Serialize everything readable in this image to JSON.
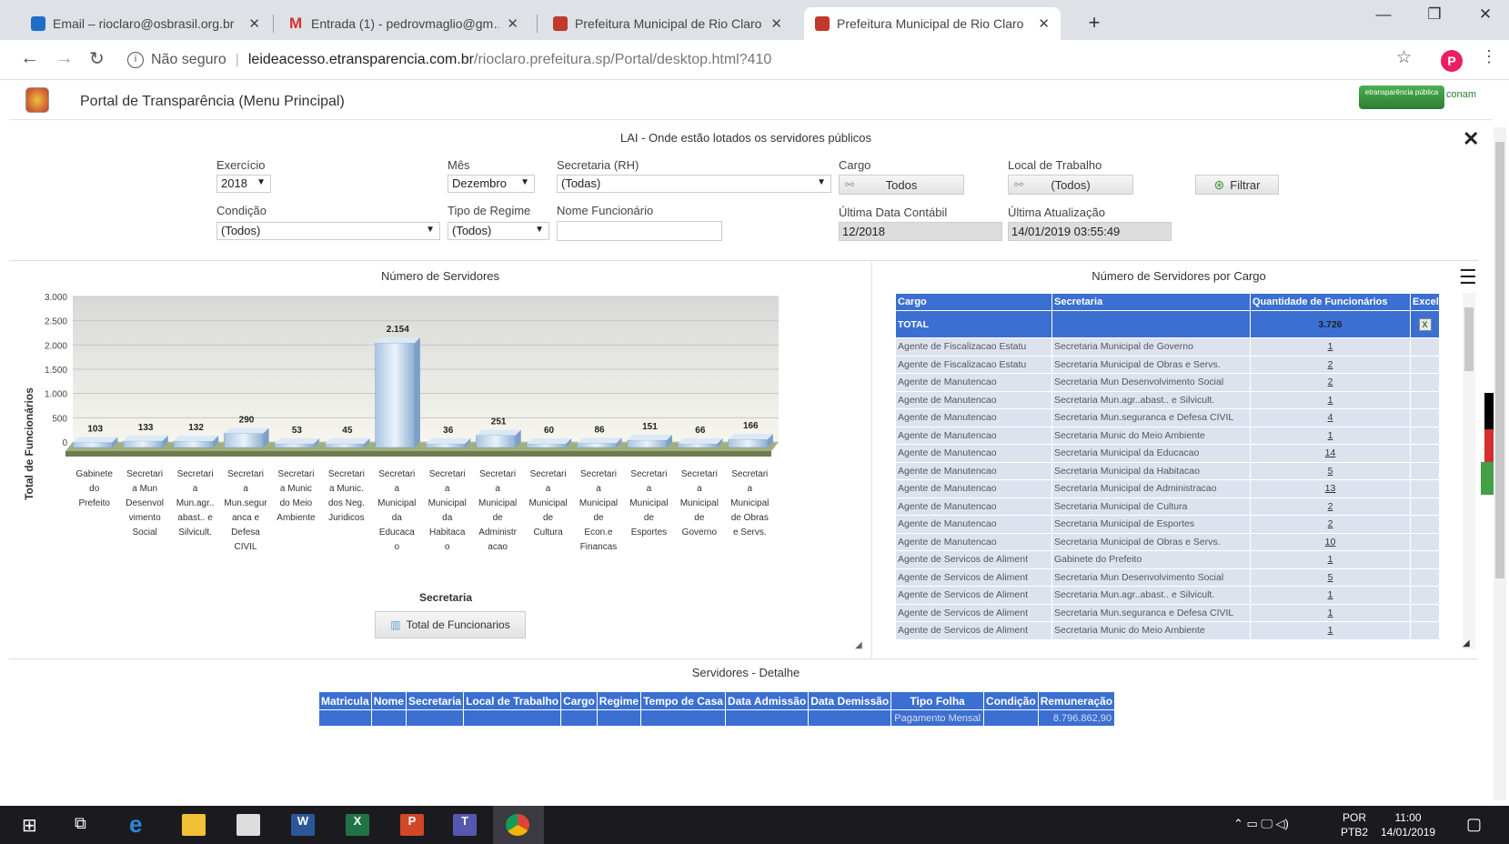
{
  "browser": {
    "tabs": [
      {
        "title": "Email – rioclaro@osbrasil.org.br",
        "icon_color": "#1f6fc8"
      },
      {
        "title": "Entrada (1) - pedrovmaglio@gm…",
        "icon_color": "#d93025"
      },
      {
        "title": "Prefeitura Municipal de Rio Claro",
        "icon_color": "#c0392b"
      },
      {
        "title": "Prefeitura Municipal de Rio Claro",
        "icon_color": "#c0392b"
      }
    ],
    "new_tab": "+",
    "not_secure": "Não seguro",
    "url_host": "leideacesso.etransparencia.com.br",
    "url_path": "/rioclaro.prefeitura.sp/Portal/desktop.html?410",
    "profile_initial": "P",
    "profile_color": "#e91e63"
  },
  "portal": {
    "title": "Portal de Transparência (Menu Principal)",
    "logo_text": "etransparência pública",
    "logo2_text": "conam"
  },
  "filters": {
    "panel_title": "LAI - Onde estão lotados os servidores públicos",
    "exercicio_label": "Exercício",
    "exercicio_value": "2018",
    "mes_label": "Mês",
    "mes_value": "Dezembro",
    "secretaria_label": "Secretaria (RH)",
    "secretaria_value": "(Todas)",
    "cargo_label": "Cargo",
    "cargo_value": "Todos",
    "local_label": "Local de Trabalho",
    "local_value": "(Todos)",
    "filtrar_label": "Filtrar",
    "condicao_label": "Condição",
    "condicao_value": "(Todos)",
    "regime_label": "Tipo de Regime",
    "regime_value": "(Todos)",
    "nome_label": "Nome Funcionário",
    "nome_value": "",
    "ultima_data_label": "Última Data Contábil",
    "ultima_data_value": "12/2018",
    "ultima_atual_label": "Última Atualização",
    "ultima_atual_value": "14/01/2019 03:55:49"
  },
  "chart_panel": {
    "title": "Número de Servidores",
    "button_label": "Total de Funcionarios"
  },
  "chart_data": {
    "type": "bar",
    "title": "",
    "xlabel": "Secretaria",
    "ylabel": "Total de Funcionários",
    "ylim": [
      0,
      3000
    ],
    "yticks": [
      "3.000",
      "2.500",
      "2.000",
      "1.500",
      "1.000",
      "500",
      "0"
    ],
    "categories": [
      [
        "Gabinete",
        "do",
        "Prefeito"
      ],
      [
        "Secretari",
        "a Mun",
        "Desenvol",
        "vimento",
        "Social"
      ],
      [
        "Secretari",
        "a",
        "Mun.agr..",
        "abast.. e",
        "Silvicult."
      ],
      [
        "Secretari",
        "a",
        "Mun.segur",
        "anca e",
        "Defesa",
        "CIVIL"
      ],
      [
        "Secretari",
        "a Munic",
        "do Meio",
        "Ambiente"
      ],
      [
        "Secretari",
        "a Munic.",
        "dos Neg.",
        "Juridicos"
      ],
      [
        "Secretari",
        "a",
        "Municipal",
        "da",
        "Educaca",
        "o"
      ],
      [
        "Secretari",
        "a",
        "Municipal",
        "da",
        "Habitaca",
        "o"
      ],
      [
        "Secretari",
        "a",
        "Municipal",
        "de",
        "Administr",
        "acao"
      ],
      [
        "Secretari",
        "a",
        "Municipal",
        "de",
        "Cultura"
      ],
      [
        "Secretari",
        "a",
        "Municipal",
        "de",
        "Econ.e",
        "Financas"
      ],
      [
        "Secretari",
        "a",
        "Municipal",
        "de",
        "Esportes"
      ],
      [
        "Secretari",
        "a",
        "Municipal",
        "de",
        "Governo"
      ],
      [
        "Secretari",
        "a",
        "Municipal",
        "de Obras",
        "e Servs."
      ]
    ],
    "values": [
      103,
      133,
      132,
      290,
      53,
      45,
      2154,
      36,
      251,
      60,
      86,
      151,
      66,
      166
    ],
    "labels": [
      "103",
      "133",
      "132",
      "290",
      "53",
      "45",
      "2.154",
      "36",
      "251",
      "60",
      "86",
      "151",
      "66",
      "166"
    ],
    "grid": true,
    "style": "3d"
  },
  "grid_panel": {
    "title": "Número de Servidores por Cargo",
    "headers": [
      "Cargo",
      "Secretaria",
      "Quantidade de Funcionários",
      "Excel"
    ],
    "total_label": "TOTAL",
    "total_value": "3.726",
    "rows": [
      {
        "cargo": "Agente de Fiscalizacao Estatu",
        "sec": "Secretaria Municipal de Governo",
        "q": "1"
      },
      {
        "cargo": "Agente de Fiscalizacao Estatu",
        "sec": "Secretaria Municipal de Obras e Servs.",
        "q": "2"
      },
      {
        "cargo": "Agente de Manutencao",
        "sec": "Secretaria Mun Desenvolvimento Social",
        "q": "2"
      },
      {
        "cargo": "Agente de Manutencao",
        "sec": "Secretaria Mun.agr..abast.. e Silvicult.",
        "q": "1"
      },
      {
        "cargo": "Agente de Manutencao",
        "sec": "Secretaria Mun.seguranca e Defesa CIVIL",
        "q": "4"
      },
      {
        "cargo": "Agente de Manutencao",
        "sec": "Secretaria Munic do Meio Ambiente",
        "q": "1"
      },
      {
        "cargo": "Agente de Manutencao",
        "sec": "Secretaria Municipal da Educacao",
        "q": "14"
      },
      {
        "cargo": "Agente de Manutencao",
        "sec": "Secretaria Municipal da Habitacao",
        "q": "5"
      },
      {
        "cargo": "Agente de Manutencao",
        "sec": "Secretaria Municipal de Administracao",
        "q": "13"
      },
      {
        "cargo": "Agente de Manutencao",
        "sec": "Secretaria Municipal de Cultura",
        "q": "2"
      },
      {
        "cargo": "Agente de Manutencao",
        "sec": "Secretaria Municipal de Esportes",
        "q": "2"
      },
      {
        "cargo": "Agente de Manutencao",
        "sec": "Secretaria Municipal de Obras e Servs.",
        "q": "10"
      },
      {
        "cargo": "Agente de Servicos de Aliment",
        "sec": "Gabinete do Prefeito",
        "q": "1"
      },
      {
        "cargo": "Agente de Servicos de Aliment",
        "sec": "Secretaria Mun Desenvolvimento Social",
        "q": "5"
      },
      {
        "cargo": "Agente de Servicos de Aliment",
        "sec": "Secretaria Mun.agr..abast.. e Silvicult.",
        "q": "1"
      },
      {
        "cargo": "Agente de Servicos de Aliment",
        "sec": "Secretaria Mun.seguranca e Defesa CIVIL",
        "q": "1"
      },
      {
        "cargo": "Agente de Servicos de Aliment",
        "sec": "Secretaria Munic do Meio Ambiente",
        "q": "1"
      }
    ]
  },
  "detail_panel": {
    "title": "Servidores - Detalhe",
    "headers": [
      "Matricula",
      "Nome",
      "Secretaria",
      "Local de Trabalho",
      "Cargo",
      "Regime",
      "Tempo de Casa",
      "Data Admissão",
      "Data Demissão",
      "Tipo Folha",
      "Condição",
      "Remuneração"
    ],
    "row": [
      "",
      "",
      "",
      "",
      "",
      "",
      "",
      "",
      "",
      "Pagamento Mensal",
      "",
      "8.796.862,90"
    ]
  },
  "taskbar": {
    "lang": "POR",
    "layout": "PTB2",
    "time": "11:00",
    "date": "14/01/2019"
  }
}
